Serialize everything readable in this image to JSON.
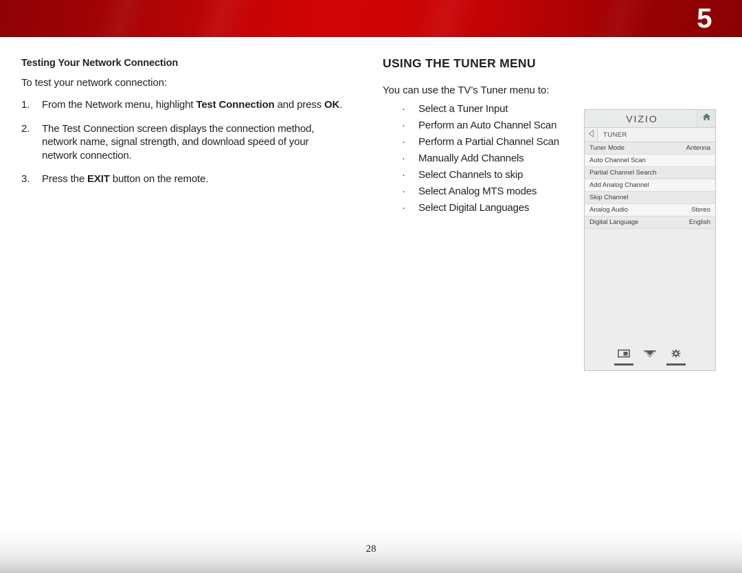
{
  "header": {
    "chapter_number": "5",
    "band_color_left": "#8d0205",
    "band_color_mid": "#d20406",
    "band_color_right": "#8a0103"
  },
  "footer": {
    "page_number": "28"
  },
  "left_column": {
    "subheading": "Testing Your Network Connection",
    "intro": "To test your network connection:",
    "steps": [
      {
        "number": "1.",
        "parts": [
          {
            "text": "From the Network menu, highlight ",
            "bold": false
          },
          {
            "text": "Test Connection",
            "bold": true
          },
          {
            "text": " and press ",
            "bold": false
          },
          {
            "text": "OK",
            "bold": true
          },
          {
            "text": ".",
            "bold": false
          }
        ]
      },
      {
        "number": "2.",
        "parts": [
          {
            "text": "The Test Connection screen displays the connection method, network name, signal strength, and download speed of your network connection.",
            "bold": false
          }
        ]
      },
      {
        "number": "3.",
        "parts": [
          {
            "text": "Press the ",
            "bold": false
          },
          {
            "text": "EXIT",
            "bold": true
          },
          {
            "text": " button on the remote.",
            "bold": false
          }
        ]
      }
    ]
  },
  "right_column": {
    "heading": "USING THE TUNER MENU",
    "lead": "You can use the TV’s Tuner menu to:",
    "bullet_char": "·",
    "bullets": [
      "Select a Tuner Input",
      "Perform an Auto Channel Scan",
      "Perform a Partial Channel Scan",
      "Manually Add Channels",
      "Select Channels to skip",
      "Select Analog MTS modes",
      "Select Digital Languages"
    ]
  },
  "osd_panel": {
    "brand_logo": "VIZIO",
    "home_icon": "home-icon",
    "back_icon": "back-arrow-icon",
    "breadcrumb": "TUNER",
    "rows": [
      {
        "label": "Tuner Mode",
        "value": "Antenna"
      },
      {
        "label": "Auto Channel Scan",
        "value": ""
      },
      {
        "label": "Partial Channel Search",
        "value": ""
      },
      {
        "label": "Add Analog Channel",
        "value": ""
      },
      {
        "label": "Skip Channel",
        "value": ""
      },
      {
        "label": "Analog Audio",
        "value": "Stereo"
      },
      {
        "label": "Digital Language",
        "value": "English"
      }
    ],
    "footer_icons": [
      {
        "name": "picture-mode-icon",
        "underline": true
      },
      {
        "name": "chevron-double-down-icon",
        "underline": false
      },
      {
        "name": "settings-gear-icon",
        "underline": true
      }
    ]
  }
}
